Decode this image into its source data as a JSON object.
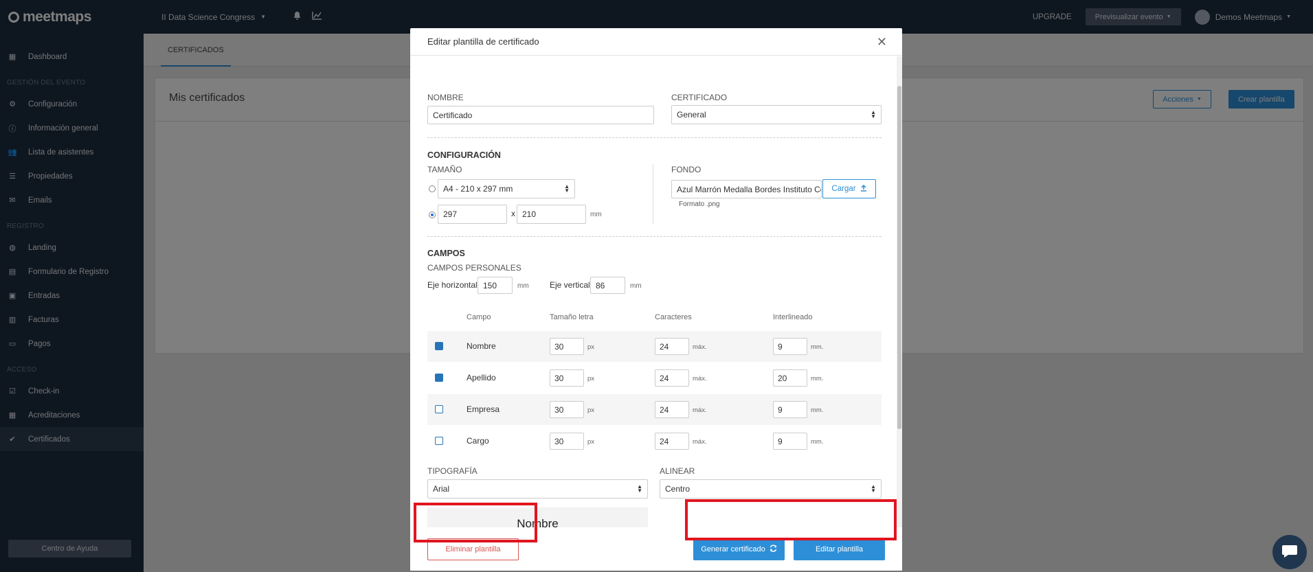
{
  "app": {
    "logo": "meetmaps"
  },
  "sidebar": {
    "items": [
      {
        "label": "Dashboard",
        "icon": "dashboard-icon"
      },
      {
        "section": "GESTIÓN DEL EVENTO"
      },
      {
        "label": "Configuración",
        "icon": "gear-icon"
      },
      {
        "label": "Información general",
        "icon": "info-icon"
      },
      {
        "label": "Lista de asistentes",
        "icon": "users-icon"
      },
      {
        "label": "Propiedades",
        "icon": "list-icon"
      },
      {
        "label": "Emails",
        "icon": "mail-icon"
      },
      {
        "section": "REGISTRO"
      },
      {
        "label": "Landing",
        "icon": "globe-icon"
      },
      {
        "label": "Formulario de Registro",
        "icon": "form-icon"
      },
      {
        "label": "Entradas",
        "icon": "ticket-icon"
      },
      {
        "label": "Facturas",
        "icon": "invoice-icon"
      },
      {
        "label": "Pagos",
        "icon": "card-icon"
      },
      {
        "section": "ACCESO"
      },
      {
        "label": "Check-in",
        "icon": "checkin-icon"
      },
      {
        "label": "Acreditaciones",
        "icon": "badge-icon"
      },
      {
        "label": "Certificados",
        "icon": "certificate-icon",
        "active": true
      }
    ],
    "help": "Centro de Ayuda"
  },
  "topbar": {
    "event": "II Data Science Congress",
    "upgrade": "UPGRADE",
    "preview": "Previsualizar evento",
    "user": "Demos Meetmaps"
  },
  "page": {
    "tab": "CERTIFICADOS",
    "title": "Mis certificados",
    "acciones": "Acciones",
    "crear": "Crear plantilla"
  },
  "modal": {
    "title": "Editar plantilla de certificado",
    "nombre_label": "NOMBRE",
    "nombre_value": "Certificado",
    "certificado_label": "CERTIFICADO",
    "certificado_value": "General",
    "config_title": "CONFIGURACIÓN",
    "tamano_label": "TAMAÑO",
    "tamano_select": "A4 - 210 x 297 mm",
    "width": "297",
    "x": "x",
    "height": "210",
    "mm": "mm",
    "fondo_label": "FONDO",
    "fondo_value": "Azul Marrón Medalla Bordes Instituto Ce",
    "cargar": "Cargar",
    "formato": "Formato .png",
    "campos_title": "CAMPOS",
    "campos_personales": "CAMPOS PERSONALES",
    "eje_h_label": "Eje horizontal",
    "eje_h": "150",
    "eje_v_label": "Eje vertical",
    "eje_v": "86",
    "headers": {
      "campo": "Campo",
      "tamano": "Tamaño letra",
      "caracteres": "Caracteres",
      "interlineado": "Interlineado"
    },
    "units": {
      "px": "px",
      "max": "máx.",
      "mm": "mm."
    },
    "rows": [
      {
        "name": "Nombre",
        "checked": true,
        "size": "30",
        "chars": "24",
        "line": "9"
      },
      {
        "name": "Apellido",
        "checked": true,
        "size": "30",
        "chars": "24",
        "line": "20"
      },
      {
        "name": "Empresa",
        "checked": false,
        "size": "30",
        "chars": "24",
        "line": "9"
      },
      {
        "name": "Cargo",
        "checked": false,
        "size": "30",
        "chars": "24",
        "line": "9"
      }
    ],
    "tipografia_label": "TIPOGRAFÍA",
    "tipografia_value": "Arial",
    "alinear_label": "ALINEAR",
    "alinear_value": "Centro",
    "preview_text": "Nombre",
    "delete": "Eliminar plantilla",
    "generate": "Generar certificado",
    "edit": "Editar plantilla"
  },
  "colors": {
    "primary": "#2d8fd8",
    "sidebar": "#1d2c3f",
    "highlight": "#e0151f",
    "danger": "#d9534f"
  }
}
